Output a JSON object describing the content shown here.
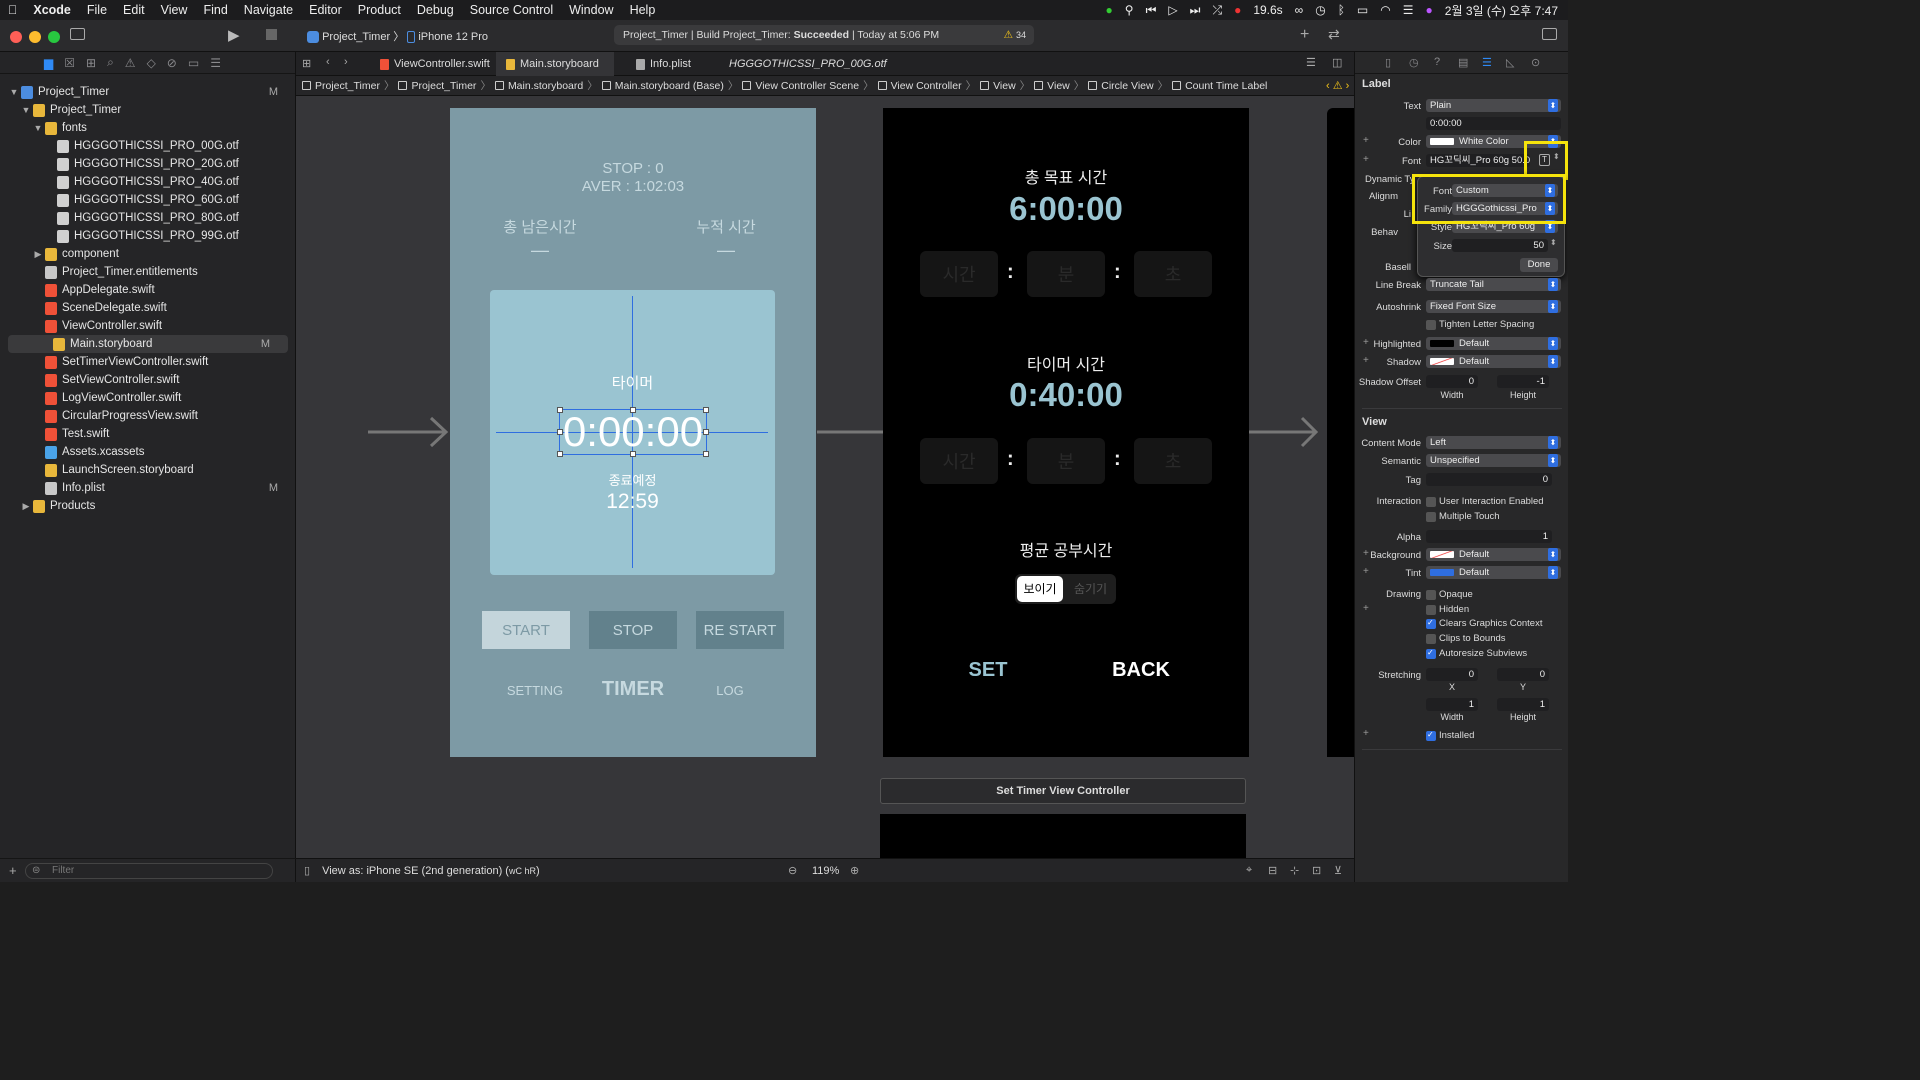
{
  "menubar": {
    "app": "Xcode",
    "items": [
      "File",
      "Edit",
      "View",
      "Find",
      "Navigate",
      "Editor",
      "Product",
      "Debug",
      "Source Control",
      "Window",
      "Help"
    ],
    "speed": "19.6s",
    "datetime": "2월 3일 (수) 오후 7:47"
  },
  "toolbar": {
    "scheme": "Project_Timer",
    "device": "iPhone 12 Pro",
    "status_prefix": "Project_Timer | Build Project_Timer: ",
    "status_result": "Succeeded",
    "status_time": " | Today at 5:06 PM",
    "warnings": "34"
  },
  "navigator": {
    "filter_placeholder": "Filter",
    "items": [
      {
        "label": "Project_Timer",
        "depth": 0,
        "type": "project",
        "open": true,
        "badge": "M"
      },
      {
        "label": "Project_Timer",
        "depth": 1,
        "type": "folder",
        "open": true,
        "badge": ""
      },
      {
        "label": "fonts",
        "depth": 2,
        "type": "folder",
        "open": true,
        "badge": ""
      },
      {
        "label": "HGGGOTHICSSI_PRO_00G.otf",
        "depth": 3,
        "type": "file",
        "badge": ""
      },
      {
        "label": "HGGGOTHICSSI_PRO_20G.otf",
        "depth": 3,
        "type": "file",
        "badge": ""
      },
      {
        "label": "HGGGOTHICSSI_PRO_40G.otf",
        "depth": 3,
        "type": "file",
        "badge": ""
      },
      {
        "label": "HGGGOTHICSSI_PRO_60G.otf",
        "depth": 3,
        "type": "file",
        "badge": ""
      },
      {
        "label": "HGGGOTHICSSI_PRO_80G.otf",
        "depth": 3,
        "type": "file",
        "badge": ""
      },
      {
        "label": "HGGGOTHICSSI_PRO_99G.otf",
        "depth": 3,
        "type": "file",
        "badge": ""
      },
      {
        "label": "component",
        "depth": 2,
        "type": "folder",
        "open": false,
        "badge": ""
      },
      {
        "label": "Project_Timer.entitlements",
        "depth": 2,
        "type": "entitlements",
        "badge": ""
      },
      {
        "label": "AppDelegate.swift",
        "depth": 2,
        "type": "swift",
        "badge": ""
      },
      {
        "label": "SceneDelegate.swift",
        "depth": 2,
        "type": "swift",
        "badge": ""
      },
      {
        "label": "ViewController.swift",
        "depth": 2,
        "type": "swift",
        "badge": ""
      },
      {
        "label": "Main.storyboard",
        "depth": 2,
        "type": "storyboard",
        "badge": "M",
        "selected": true
      },
      {
        "label": "SetTimerViewController.swift",
        "depth": 2,
        "type": "swift",
        "badge": ""
      },
      {
        "label": "SetViewController.swift",
        "depth": 2,
        "type": "swift",
        "badge": ""
      },
      {
        "label": "LogViewController.swift",
        "depth": 2,
        "type": "swift",
        "badge": ""
      },
      {
        "label": "CircularProgressView.swift",
        "depth": 2,
        "type": "swift",
        "badge": ""
      },
      {
        "label": "Test.swift",
        "depth": 2,
        "type": "swift",
        "badge": ""
      },
      {
        "label": "Assets.xcassets",
        "depth": 2,
        "type": "assets",
        "badge": ""
      },
      {
        "label": "LaunchScreen.storyboard",
        "depth": 2,
        "type": "storyboard",
        "badge": ""
      },
      {
        "label": "Info.plist",
        "depth": 2,
        "type": "plist",
        "badge": "M"
      },
      {
        "label": "Products",
        "depth": 1,
        "type": "folder",
        "open": false,
        "badge": ""
      }
    ]
  },
  "tabs": [
    {
      "label": "ViewController.swift",
      "active": false
    },
    {
      "label": "Main.storyboard",
      "active": true
    },
    {
      "label": "Info.plist",
      "active": false
    },
    {
      "label": "HGGGOTHICSSI_PRO_00G.otf",
      "active": false,
      "italic": true
    }
  ],
  "breadcrumb": [
    "Project_Timer",
    "Project_Timer",
    "Main.storyboard",
    "Main.storyboard (Base)",
    "View Controller Scene",
    "View Controller",
    "View",
    "View",
    "Circle View",
    "Count Time Label"
  ],
  "scene1": {
    "stop": "STOP : 0",
    "aver": "AVER : 1:02:03",
    "remaining_label": "총 남은시간",
    "remaining_value": "—",
    "total_label": "누적 시간",
    "total_value": "—",
    "timer_label": "타이머",
    "time": "0:00:00",
    "end_label": "종료예정",
    "end_time": "12:59",
    "start": "START",
    "stop_btn": "STOP",
    "restart": "RE START",
    "tab_setting": "SETTING",
    "tab_timer": "TIMER",
    "tab_log": "LOG"
  },
  "scene2": {
    "goal_label": "총 목표 시간",
    "goal_time": "6:00:00",
    "timer_label": "타이머 시간",
    "timer_time": "0:40:00",
    "hour": "시간",
    "minute": "분",
    "second": "초",
    "avg_label": "평균 공부시간",
    "show": "보이기",
    "hide": "숨기기",
    "set": "SET",
    "back": "BACK"
  },
  "scene3_title": "Set Timer View Controller",
  "bottom": {
    "view_as": "View as: iPhone SE (2nd generation) (",
    "view_as_mods": "wC hR",
    "view_as_end": ")",
    "zoom": "119%"
  },
  "inspector": {
    "label_section": "Label",
    "text_lbl": "Text",
    "text_value": "Plain",
    "text_content": "0:00:00",
    "color_lbl": "Color",
    "color_value": "White Color",
    "font_lbl": "Font",
    "font_value": "HG꼬딕씨_Pro 60g 50.0",
    "dynamic_lbl": "Dynamic Ty",
    "align_lbl": "Alignm",
    "lines_lbl": "Li",
    "behavior_lbl": "Behav",
    "popover": {
      "font_lbl": "Font",
      "font_value": "Custom",
      "family_lbl": "Family",
      "family_value": "HGGGothicssi_Pro",
      "style_lbl": "Style",
      "style_value": "HG꼬딕씨_Pro 60g",
      "size_lbl": "Size",
      "size_value": "50",
      "done": "Done"
    },
    "baseline_lbl": "Basell",
    "linebreak_lbl": "Line Break",
    "linebreak_value": "Truncate Tail",
    "autoshrink_lbl": "Autoshrink",
    "autoshrink_value": "Fixed Font Size",
    "tighten": "Tighten Letter Spacing",
    "highlighted_lbl": "Highlighted",
    "highlighted_value": "Default",
    "shadow_lbl": "Shadow",
    "shadow_value": "Default",
    "shadow_offset_lbl": "Shadow Offset",
    "shadow_w": "0",
    "shadow_h": "-1",
    "width_lbl": "Width",
    "height_lbl": "Height",
    "view_section": "View",
    "content_mode_lbl": "Content Mode",
    "content_mode_value": "Left",
    "semantic_lbl": "Semantic",
    "semantic_value": "Unspecified",
    "tag_lbl": "Tag",
    "tag_value": "0",
    "interaction_lbl": "Interaction",
    "user_interaction": "User Interaction Enabled",
    "multiple_touch": "Multiple Touch",
    "alpha_lbl": "Alpha",
    "alpha_value": "1",
    "background_lbl": "Background",
    "background_value": "Default",
    "tint_lbl": "Tint",
    "tint_value": "Default",
    "drawing_lbl": "Drawing",
    "opaque": "Opaque",
    "hidden": "Hidden",
    "clears": "Clears Graphics Context",
    "clips": "Clips to Bounds",
    "autoresize": "Autoresize Subviews",
    "stretching_lbl": "Stretching",
    "stretch_x": "0",
    "stretch_y": "0",
    "x_lbl": "X",
    "y_lbl": "Y",
    "stretch_w": "1",
    "stretch_h": "1",
    "installed": "Installed"
  },
  "colors": {
    "scene_bg": "#7d9aa5",
    "circle": "#9ac4d1",
    "highlight": "#f5e30c",
    "accent": "#2f6ee0"
  }
}
